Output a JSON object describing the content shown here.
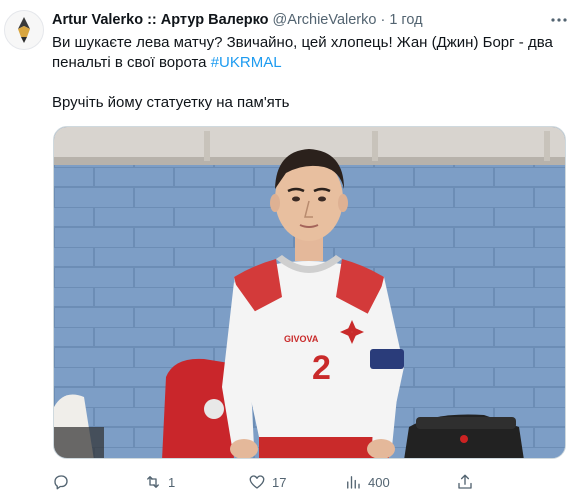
{
  "tweet": {
    "display_name": "Artur Valerko :: Артур Валерко",
    "handle": "@ArchieValerko",
    "dot": "·",
    "time": "1 год",
    "more_icon": "more-horizontal-icon",
    "text_line1": "Ви шукаєте лева матчу? Звичайно, цей хлопець! Жан (Джин) Борг - два",
    "text_line2_prefix": "пенальті в свої ворота ",
    "hashtag": "#UKRMAL",
    "text_line3": "Вручіть йому статуетку на пам'ять",
    "media": {
      "shirt_brand": "GIVOVA",
      "shirt_number": "2"
    },
    "actions": {
      "reply_count": "",
      "retweet_count": "1",
      "like_count": "17",
      "views_count": "400"
    }
  },
  "colors": {
    "link": "#1d9bf0",
    "secondary": "#536471",
    "text": "#0f1419"
  }
}
